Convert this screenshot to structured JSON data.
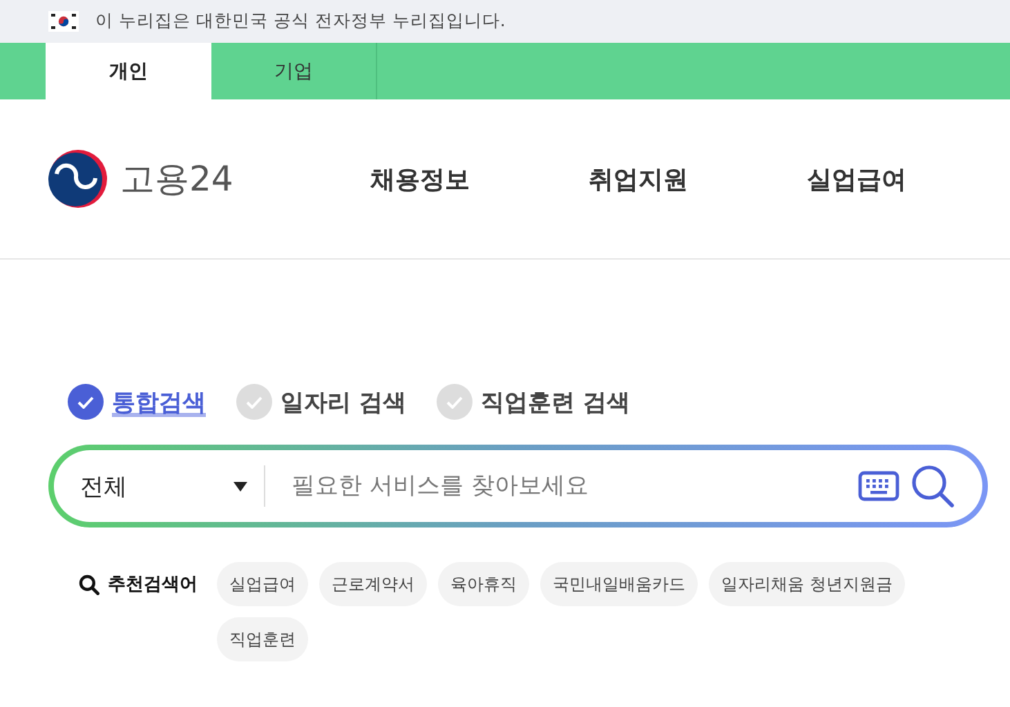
{
  "gov_banner": {
    "text": "이 누리집은 대한민국 공식 전자정부 누리집입니다."
  },
  "user_tabs": [
    {
      "label": "개인",
      "selected": true
    },
    {
      "label": "기업",
      "selected": false
    }
  ],
  "header": {
    "logo_text": "고용24",
    "nav": [
      "채용정보",
      "취업지원",
      "실업급여"
    ]
  },
  "search": {
    "scopes": [
      {
        "label": "통합검색",
        "selected": true
      },
      {
        "label": "일자리 검색",
        "selected": false
      },
      {
        "label": "직업훈련 검색",
        "selected": false
      }
    ],
    "category": "전체",
    "placeholder": "필요한 서비스를 찾아보세요",
    "recommend_label": "추천검색어",
    "keywords": [
      "실업급여",
      "근로계약서",
      "육아휴직",
      "국민내일배움카드",
      "일자리채움 청년지원금",
      "직업훈련"
    ]
  }
}
